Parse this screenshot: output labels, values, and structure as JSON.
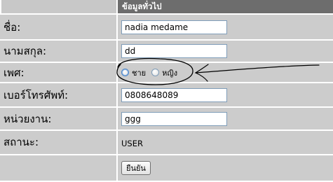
{
  "header": {
    "title": "ข้อมูลทั่วไป"
  },
  "fields": {
    "first_name": {
      "label": "ชื่อ:",
      "value": "nadia medame"
    },
    "last_name": {
      "label": "นามสกุล:",
      "value": "dd"
    },
    "gender": {
      "label": "เพศ:",
      "options": [
        "ชาย",
        "หญิง"
      ]
    },
    "phone": {
      "label": "เบอร์โทรศัพท์:",
      "value": "0808648089"
    },
    "department": {
      "label": "หน่วยงาน:",
      "value": "ggg"
    },
    "status": {
      "label": "สถานะ:",
      "value": "USER"
    }
  },
  "actions": {
    "confirm_label": "ยืนยัน"
  },
  "colors": {
    "header_bg": "#6d6d6d",
    "row_bg": "#cccccc",
    "annotation_ink": "#000000"
  }
}
